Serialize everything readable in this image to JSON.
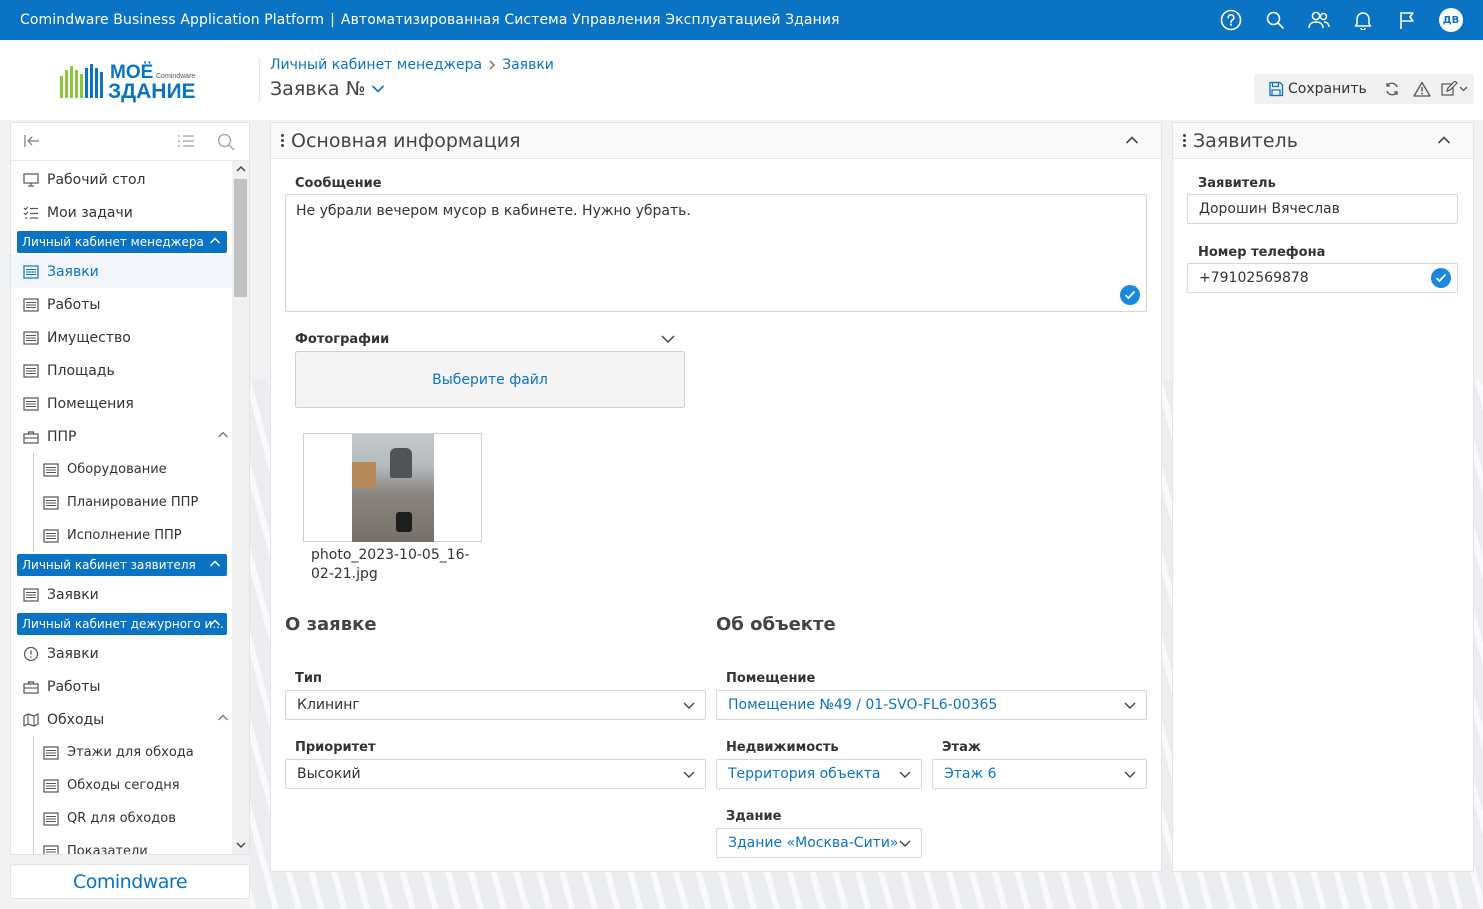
{
  "topbar": {
    "app_name": "Comindware Business Application Platform",
    "separator": "|",
    "system_name": "Автоматизированная Система Управления Эксплуатацией Здания",
    "avatar_initials": "ДВ"
  },
  "logo": {
    "line1": "МОЁ",
    "line2": "ЗДАНИЕ",
    "small": "Comindware"
  },
  "breadcrumb": {
    "item1": "Личный кабинет менеджера",
    "item2": "Заявки"
  },
  "page": {
    "title": "Заявка №"
  },
  "toolbar": {
    "save_label": "Сохранить"
  },
  "sidebar": {
    "items": [
      {
        "label": "Рабочий стол"
      },
      {
        "label": "Мои задачи"
      },
      {
        "group": "Личный кабинет менеджера"
      },
      {
        "label": "Заявки"
      },
      {
        "label": "Работы"
      },
      {
        "label": "Имущество"
      },
      {
        "label": "Площадь"
      },
      {
        "label": "Помещения"
      },
      {
        "label": "ППР"
      },
      {
        "label": "Оборудование"
      },
      {
        "label": "Планирование ППР"
      },
      {
        "label": "Исполнение ППР"
      },
      {
        "group": "Личный кабинет заявителя"
      },
      {
        "label": "Заявки"
      },
      {
        "group": "Личный кабинет дежурного и..."
      },
      {
        "label": "Заявки"
      },
      {
        "label": "Работы"
      },
      {
        "label": "Обходы"
      },
      {
        "label": "Этажи для обхода"
      },
      {
        "label": "Обходы сегодня"
      },
      {
        "label": "QR для обходов"
      },
      {
        "label": "Показатели"
      }
    ]
  },
  "footer_logo": "Comindware",
  "main_panel": {
    "title": "Основная информация",
    "message_label": "Сообщение",
    "message_value": "Не убрали вечером мусор в кабинете. Нужно убрать.",
    "photos_label": "Фотографии",
    "choose_file": "Выберите файл",
    "file_name": "photo_2023-10-05_16-02-21.jpg",
    "section_request": "О заявке",
    "section_object": "Об объекте",
    "type_label": "Тип",
    "type_value": "Клининг",
    "priority_label": "Приоритет",
    "priority_value": "Высокий",
    "room_label": "Помещение",
    "room_value": "Помещение №49 / 01-SVO-FL6-00365",
    "property_label": "Недвижимость",
    "property_value": "Территория объекта",
    "floor_label": "Этаж",
    "floor_value": "Этаж 6",
    "building_label": "Здание",
    "building_value": "Здание «Москва-Сити»"
  },
  "applicant_panel": {
    "title": "Заявитель",
    "applicant_label": "Заявитель",
    "applicant_value": "Дорошин Вячеслав",
    "phone_label": "Номер телефона",
    "phone_value": "+79102569878"
  },
  "colors": {
    "brand": "#0b73c4",
    "check": "#1a88e0"
  }
}
